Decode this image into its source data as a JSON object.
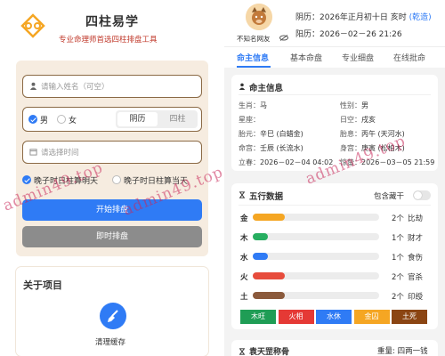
{
  "left": {
    "brand": {
      "title": "四柱易学",
      "subtitle": "专业命理师首选四柱排盘工具"
    },
    "form": {
      "name_placeholder": "请输入姓名（可空）",
      "gender_male": "男",
      "gender_female": "女",
      "calendar_options": [
        "阴历",
        "四柱"
      ],
      "calendar_selected": "阴历",
      "time_placeholder": "请选择时间",
      "zi_option_tomorrow": "晚子时日柱算明天",
      "zi_option_today": "晚子时日柱算当天",
      "start_button": "开始排盘",
      "instant_button": "即时排盘"
    },
    "about": {
      "title": "关于项目",
      "clear_cache": "清理缓存"
    }
  },
  "right": {
    "profile": {
      "nickname": "不知名网友",
      "lunar_label": "阴历：",
      "lunar_value": "2026年正月初十日 亥时",
      "lunar_hint": "(乾造)",
      "solar_label": "阳历：",
      "solar_value": "2026－02－26 21:26"
    },
    "tabs": [
      "命主信息",
      "基本命盘",
      "专业细盘",
      "在线批命"
    ],
    "info": {
      "title": "命主信息",
      "rows": [
        {
          "k": "生肖：",
          "v": "马"
        },
        {
          "k": "性别：",
          "v": "男"
        },
        {
          "k": "星座：",
          "v": ""
        },
        {
          "k": "日空：",
          "v": "戌亥"
        },
        {
          "k": "胎元：",
          "v": "辛巳 (白蜡金)"
        },
        {
          "k": "胎息：",
          "v": "丙午 (天河水)"
        },
        {
          "k": "命宫：",
          "v": "壬辰 (长流水)"
        },
        {
          "k": "身宫：",
          "v": "庚寅 (松柏木)"
        },
        {
          "k": "立春：",
          "v": "2026－02－04 04:02"
        },
        {
          "k": "惊蛰：",
          "v": "2026－03－05 21:59"
        }
      ]
    },
    "wuxing": {
      "title": "五行数据",
      "toggle_label": "包含藏干",
      "rows": [
        {
          "name": "金",
          "count": "2个",
          "god": "比劫",
          "fraction": 0.25,
          "color": "#f5a623"
        },
        {
          "name": "木",
          "count": "1个",
          "god": "财才",
          "fraction": 0.12,
          "color": "#27ae60"
        },
        {
          "name": "水",
          "count": "1个",
          "god": "食伤",
          "fraction": 0.12,
          "color": "#2f7bf5"
        },
        {
          "name": "火",
          "count": "2个",
          "god": "官杀",
          "fraction": 0.25,
          "color": "#e74c3c"
        },
        {
          "name": "土",
          "count": "2个",
          "god": "印绶",
          "fraction": 0.25,
          "color": "#8b5a3c"
        }
      ],
      "status": [
        {
          "label": "木旺",
          "color": "#1f9d55"
        },
        {
          "label": "火相",
          "color": "#e53935"
        },
        {
          "label": "水休",
          "color": "#2f7bf5"
        },
        {
          "label": "金囚",
          "color": "#f5a623"
        },
        {
          "label": "土死",
          "color": "#8b4513"
        }
      ]
    },
    "weight": {
      "title": "袁天罡称骨",
      "value": "重量: 四两一钱"
    }
  },
  "watermark": "admin49.top"
}
